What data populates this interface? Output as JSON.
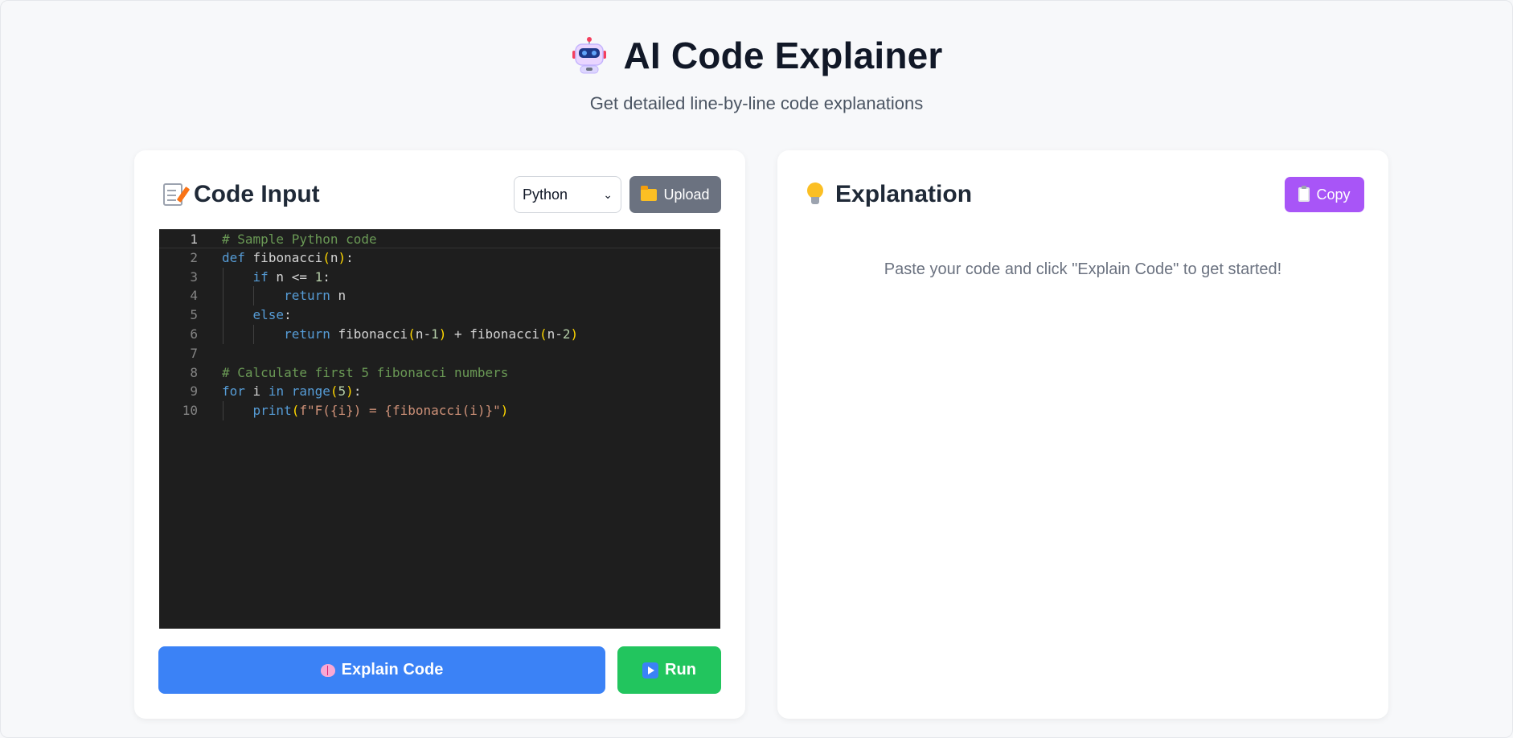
{
  "header": {
    "title": "AI Code Explainer",
    "subtitle": "Get detailed line-by-line code explanations",
    "icon": "robot-icon"
  },
  "input_panel": {
    "title": "Code Input",
    "icon": "memo-icon",
    "language_selected": "Python",
    "upload_label": "Upload",
    "explain_label": "Explain Code",
    "run_label": "Run"
  },
  "editor": {
    "active_line": 1,
    "lines": [
      "# Sample Python code",
      "def fibonacci(n):",
      "    if n <= 1:",
      "        return n",
      "    else:",
      "        return fibonacci(n-1) + fibonacci(n-2)",
      "",
      "# Calculate first 5 fibonacci numbers",
      "for i in range(5):",
      "    print(f\"F({i}) = {fibonacci(i)}\")"
    ]
  },
  "explanation_panel": {
    "title": "Explanation",
    "icon": "lightbulb-icon",
    "copy_label": "Copy",
    "placeholder": "Paste your code and click \"Explain Code\" to get started!"
  },
  "colors": {
    "explain_button": "#3b82f6",
    "run_button": "#22c55e",
    "upload_button": "#6b7280",
    "copy_button": "#a855f7",
    "editor_bg": "#1e1e1e"
  }
}
